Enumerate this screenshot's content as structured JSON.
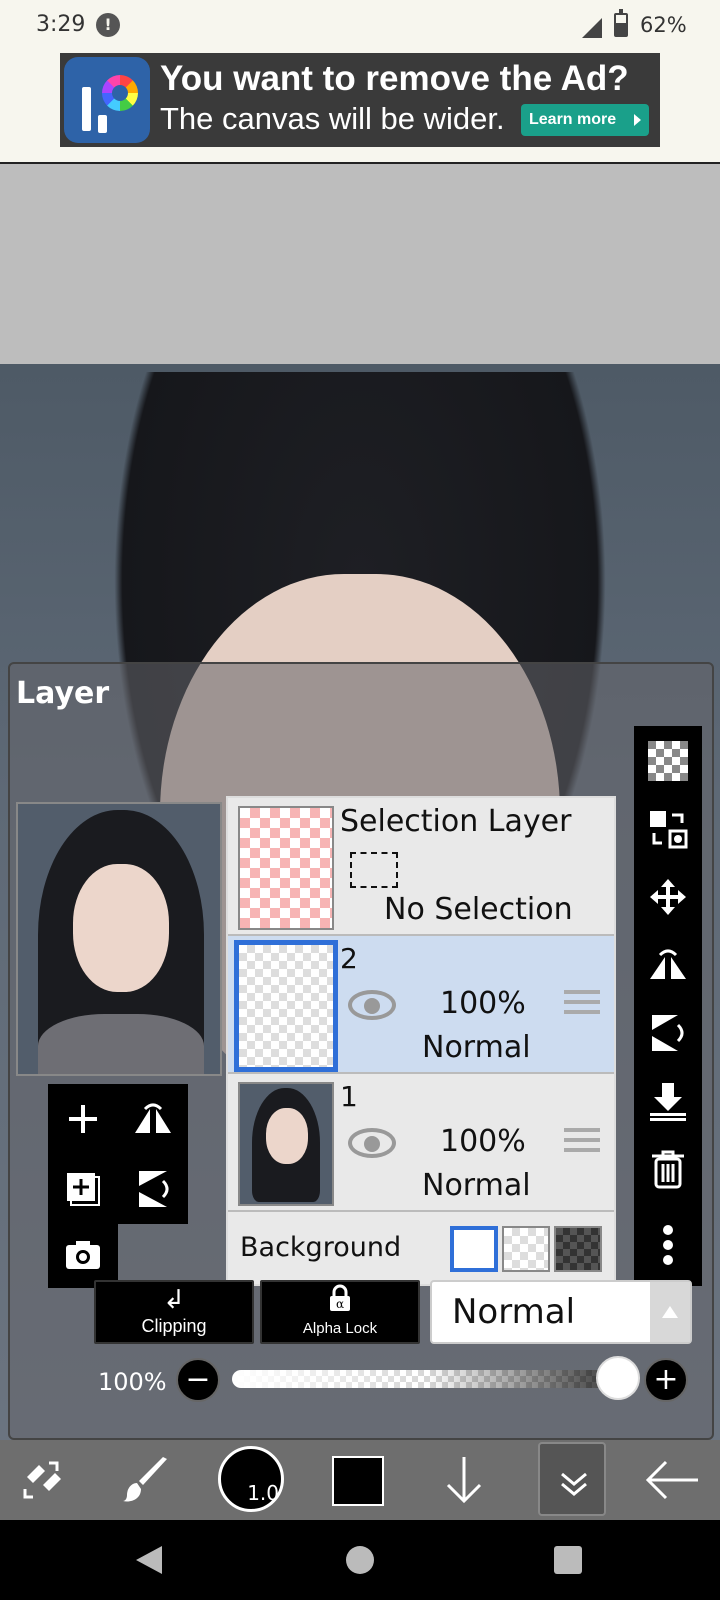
{
  "status_bar": {
    "time": "3:29",
    "battery": "62%"
  },
  "ad": {
    "title": "You want to remove the Ad?",
    "subtitle": "The canvas will be wider.",
    "cta": "Learn more"
  },
  "panel": {
    "title": "Layer"
  },
  "layers": [
    {
      "name": "Selection Layer",
      "status": "No Selection"
    },
    {
      "name": "2",
      "opacity": "100%",
      "blend": "Normal",
      "selected": true
    },
    {
      "name": "1",
      "opacity": "100%",
      "blend": "Normal",
      "selected": false
    }
  ],
  "background": {
    "label": "Background",
    "options": [
      "white",
      "transparent",
      "dark-checker"
    ],
    "selected": "white"
  },
  "controls": {
    "clipping_label": "Clipping",
    "alpha_lock_label": "Alpha Lock",
    "blend_mode": "Normal",
    "opacity": "100%",
    "opacity_value": 1.0
  },
  "toolbar": {
    "brush_size": "1.0",
    "color": "#000000"
  },
  "colors": {
    "selection_accent": "#2f6fd8",
    "selected_row": "#cddcf0",
    "ad_cta": "#1aa08a"
  },
  "icons": {
    "left_tools": [
      "plus-icon",
      "flip-horizontal-icon",
      "add-layer-icon",
      "flip-vertical-icon",
      "camera-icon"
    ],
    "right_tools": [
      "checkerboard-icon",
      "transform-icon",
      "move-icon",
      "flip-horizontal-icon",
      "flip-vertical-icon",
      "merge-down-icon",
      "trash-icon",
      "more-icon"
    ]
  }
}
